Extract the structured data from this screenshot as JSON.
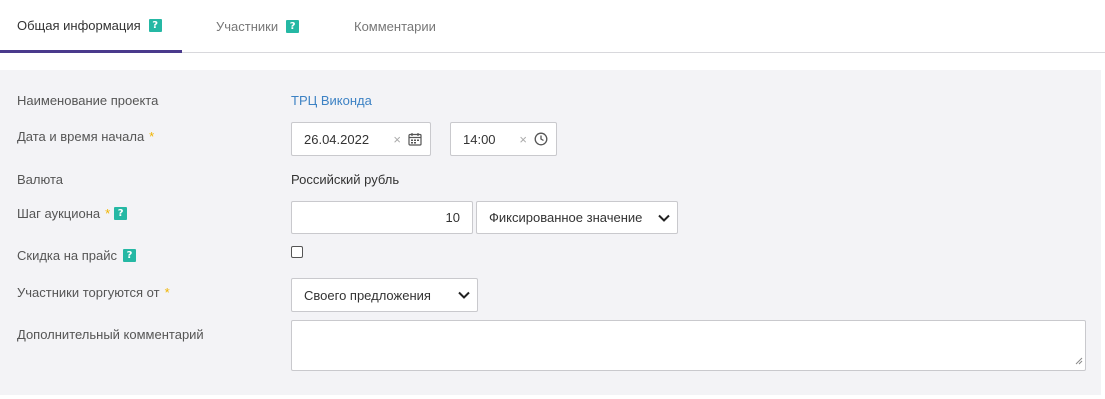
{
  "tabs": [
    {
      "label": "Общая информация",
      "help": "?",
      "active": true
    },
    {
      "label": "Участники",
      "help": "?",
      "active": false
    },
    {
      "label": "Комментарии",
      "active": false
    }
  ],
  "form": {
    "project_name": {
      "label": "Наименование проекта",
      "value": "ТРЦ Виконда"
    },
    "start": {
      "label": "Дата и время начала",
      "required": "*",
      "date": "26.04.2022",
      "time": "14:00",
      "clear": "×"
    },
    "currency": {
      "label": "Валюта",
      "value": "Российский рубль"
    },
    "auction_step": {
      "label": "Шаг аукциона",
      "required": "*",
      "help": "?",
      "value": "10",
      "type_selected": "Фиксированное значение"
    },
    "price_discount": {
      "label": "Скидка на прайс",
      "help": "?",
      "checked": false
    },
    "bidding_from": {
      "label": "Участники торгуются от",
      "required": "*",
      "selected": "Своего предложения"
    },
    "comment": {
      "label": "Дополнительный комментарий",
      "value": ""
    }
  },
  "colors": {
    "accent_tab": "#4a3a8c",
    "help_badge": "#25b8a4",
    "link": "#3d82c4",
    "required": "#f0b400",
    "panel_bg": "#f3f3f6"
  },
  "icons": [
    "help-icon",
    "calendar-icon",
    "clock-icon",
    "clear-icon",
    "chevron-down-icon",
    "resize-grip-icon"
  ]
}
